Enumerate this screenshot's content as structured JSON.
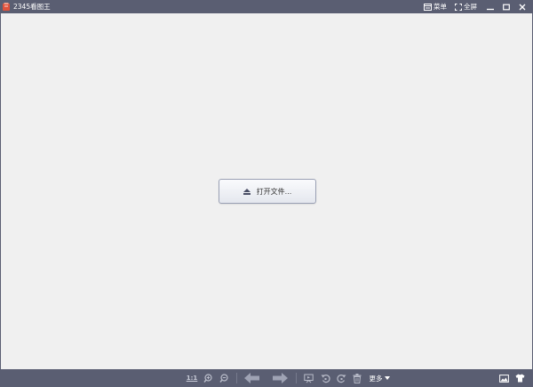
{
  "titlebar": {
    "app_title": "2345看图王",
    "menu_label": "菜单",
    "fullscreen_label": "全屏"
  },
  "main": {
    "open_file_label": "打开文件..."
  },
  "toolbar": {
    "actual_size_label": "1:1",
    "more_label": "更多"
  },
  "colors": {
    "chrome": "#5a5e72",
    "canvas": "#f0f0f0",
    "logo": "#e0523c"
  },
  "icons": [
    "app-logo-icon",
    "menu-icon",
    "fullscreen-icon",
    "minimize-icon",
    "maximize-icon",
    "close-icon",
    "eject-icon",
    "zoom-in-icon",
    "zoom-out-icon",
    "previous-arrow-icon",
    "next-arrow-icon",
    "slideshow-icon",
    "rotate-left-icon",
    "rotate-right-icon",
    "delete-icon",
    "chevron-down-icon",
    "wallpaper-icon",
    "skin-shirt-icon"
  ]
}
